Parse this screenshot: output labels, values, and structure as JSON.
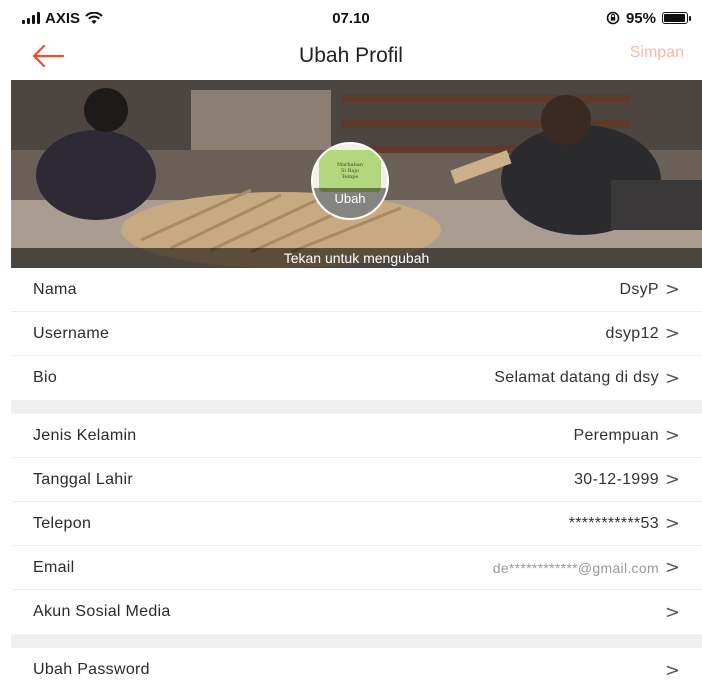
{
  "status_bar": {
    "carrier": "AXIS",
    "time": "07.10",
    "battery": "95%",
    "battery_level": 0.95,
    "icons": [
      "signal-icon",
      "wifi-icon",
      "rotation-lock-icon",
      "battery-icon"
    ]
  },
  "header": {
    "title": "Ubah Profil",
    "save_label": "Simpan",
    "back_icon": "arrow-left-icon",
    "accent_color": "#ee4d2d",
    "save_color_disabled": "#f6b9a6"
  },
  "cover": {
    "avatar_label": "Ubah",
    "hint": "Tekan untuk mengubah"
  },
  "profile": {
    "name": {
      "label": "Nama",
      "value": "DsyP"
    },
    "username": {
      "label": "Username",
      "value": "dsyp12"
    },
    "bio": {
      "label": "Bio",
      "value": "Selamat datang di dsy"
    },
    "gender": {
      "label": "Jenis Kelamin",
      "value": "Perempuan"
    },
    "birthdate": {
      "label": "Tanggal Lahir",
      "value": "30-12-1999"
    },
    "phone": {
      "label": "Telepon",
      "value": "***********53"
    },
    "email": {
      "label": "Email",
      "value": "de************@gmail.com"
    },
    "social": {
      "label": "Akun Sosial Media",
      "value": ""
    },
    "password": {
      "label": "Ubah Password",
      "value": ""
    }
  },
  "chevron": ">"
}
